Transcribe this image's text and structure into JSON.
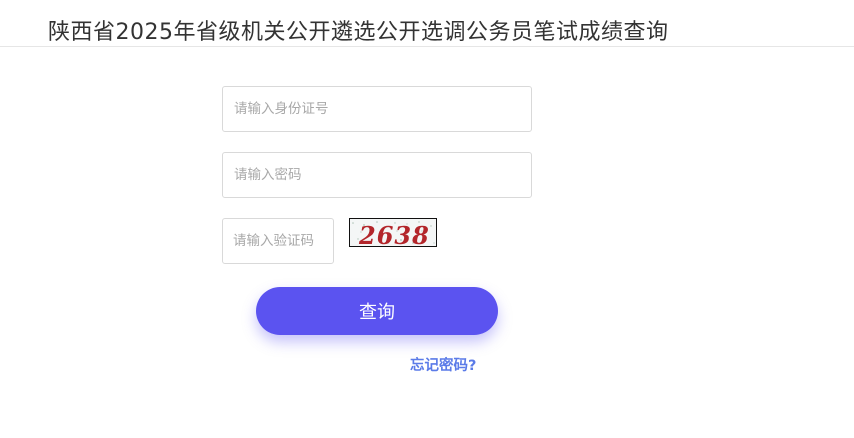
{
  "page": {
    "title": "陕西省2025年省级机关公开遴选公开选调公务员笔试成绩查询"
  },
  "form": {
    "id_placeholder": "请输入身份证号",
    "password_placeholder": "请输入密码",
    "captcha_placeholder": "请输入验证码",
    "captcha_text": "2638",
    "submit_label": "查询",
    "forgot_label": "忘记密码?"
  },
  "colors": {
    "accent": "#5b53f0",
    "link": "#5b7be8",
    "captcha_text": "#b3262b"
  }
}
